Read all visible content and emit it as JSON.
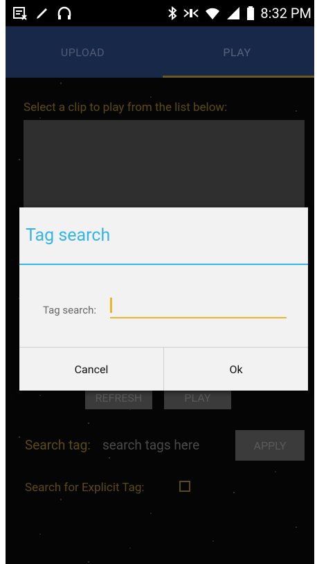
{
  "status_bar": {
    "time": "8:32 PM",
    "icons_left": [
      "notification-icon",
      "pen-icon",
      "headphones-icon"
    ],
    "icons_right": [
      "bluetooth-icon",
      "nfc-icon",
      "wifi-icon",
      "signal-icon",
      "battery-icon"
    ]
  },
  "tabs": [
    {
      "label": "UPLOAD",
      "active": false
    },
    {
      "label": "PLAY",
      "active": true
    }
  ],
  "main": {
    "prompt": "Select a clip to play from the list below:",
    "refresh_label": "REFRESH",
    "play_label": "PLAY",
    "search_tag_label": "Search tag:",
    "search_tag_placeholder": "search tags here",
    "apply_label": "APPLY",
    "explicit_label": "Search for Explicit Tag:"
  },
  "dialog": {
    "title": "Tag search",
    "field_label": "Tag search:",
    "field_value": "",
    "cancel_label": "Cancel",
    "ok_label": "Ok"
  },
  "colors": {
    "accent": "#33b5e5",
    "input_underline": "#f0b429",
    "tab_bar": "#172849"
  }
}
